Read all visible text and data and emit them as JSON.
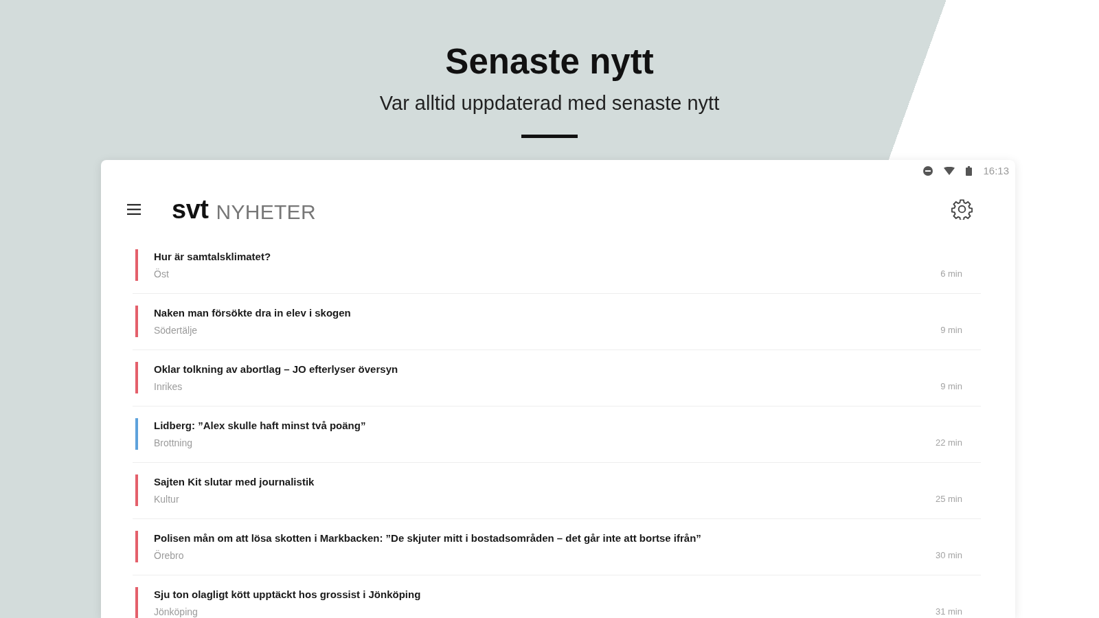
{
  "hero": {
    "title": "Senaste nytt",
    "subtitle": "Var alltid uppdaterad med senaste nytt"
  },
  "status_bar": {
    "time": "16:13"
  },
  "app_bar": {
    "logo": "svt",
    "section": "NYHETER"
  },
  "news": [
    {
      "title": "Hur är samtalsklimatet?",
      "section": "Öst",
      "age": "6 min",
      "color": "#e4606b"
    },
    {
      "title": "Naken man försökte dra in elev i skogen",
      "section": "Södertälje",
      "age": "9 min",
      "color": "#e4606b"
    },
    {
      "title": "Oklar tolkning av abortlag – JO efterlyser översyn",
      "section": "Inrikes",
      "age": "9 min",
      "color": "#e4606b"
    },
    {
      "title": "Lidberg: ”Alex skulle haft minst två poäng”",
      "section": "Brottning",
      "age": "22 min",
      "color": "#5ea2dc"
    },
    {
      "title": "Sajten Kit slutar med journalistik",
      "section": "Kultur",
      "age": "25 min",
      "color": "#e4606b"
    },
    {
      "title": "Polisen mån om att lösa skotten i Markbacken: ”De skjuter mitt i bostadsområden – det går inte att bortse ifrån”",
      "section": "Örebro",
      "age": "30 min",
      "color": "#e4606b"
    },
    {
      "title": "Sju ton olagligt kött upptäckt hos grossist i Jönköping",
      "section": "Jönköping",
      "age": "31 min",
      "color": "#e4606b"
    }
  ]
}
